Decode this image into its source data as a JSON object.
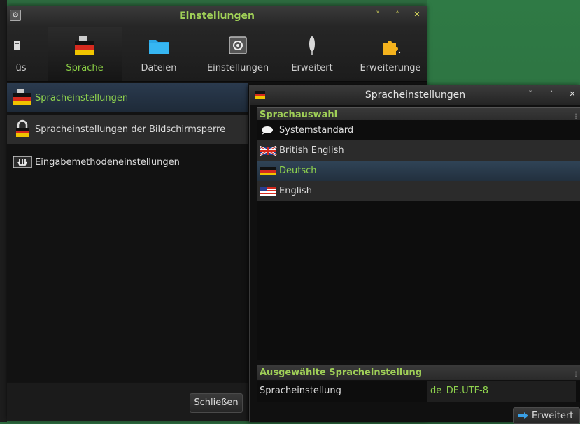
{
  "main_window": {
    "title": "Einstellungen",
    "controls": {
      "minimize": "˅",
      "maximize": "˄",
      "close": "✕"
    },
    "toolbar": [
      {
        "label": "üs",
        "icon": "menu-icon"
      },
      {
        "label": "Sprache",
        "icon": "german-flag-icon",
        "active": true
      },
      {
        "label": "Dateien",
        "icon": "folder-icon"
      },
      {
        "label": "Einstellungen",
        "icon": "settings-icon"
      },
      {
        "label": "Erweitert",
        "icon": "tool-icon"
      },
      {
        "label": "Erweiterunge",
        "icon": "puzzle-icon"
      }
    ],
    "nav": [
      {
        "label": "Spracheinstellungen",
        "icon": "german-flag-icon",
        "selected": true
      },
      {
        "label": "Spracheinstellungen der Bildschirmsperre",
        "icon": "lock-icon"
      },
      {
        "label": "Eingabemethodeneinstellungen",
        "icon": "keyboard-icon"
      }
    ],
    "close_button": "Schließen"
  },
  "language_dialog": {
    "title": "Spracheinstellungen",
    "controls": {
      "minimize": "˅",
      "maximize": "˄",
      "close": "✕"
    },
    "section_language_selection": "Sprachauswahl",
    "languages": [
      {
        "label": "Systemstandard",
        "icon": "speech-bubble-icon"
      },
      {
        "label": "British English",
        "icon": "uk-flag-icon"
      },
      {
        "label": "Deutsch",
        "icon": "german-flag-icon",
        "selected": true
      },
      {
        "label": "English",
        "icon": "us-flag-icon"
      }
    ],
    "section_selected": "Ausgewählte Spracheinstellung",
    "setting_key": "Spracheinstellung",
    "setting_value": "de_DE.UTF-8",
    "advanced_button": "Erweitert"
  },
  "colors": {
    "accent_green": "#8fd34e",
    "title_green": "#9fcf57",
    "selection_blue": "#2a3a4e"
  }
}
